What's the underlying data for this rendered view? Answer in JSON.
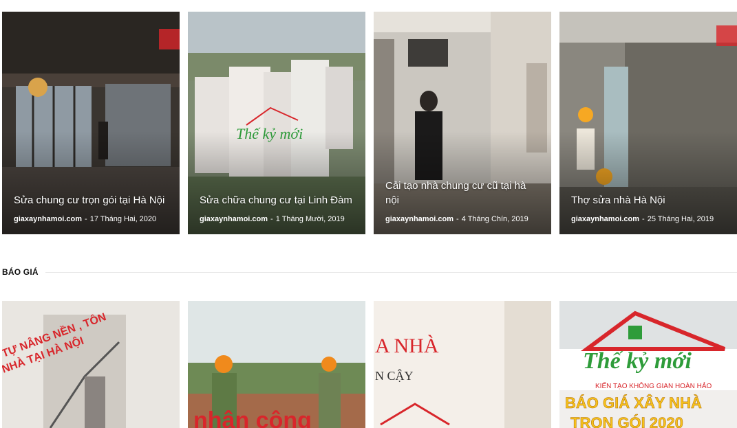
{
  "posts_top": [
    {
      "title": "Sửa chung cư trọn gói tại Hà Nội",
      "site": "giaxaynhamoi.com",
      "separator": "-",
      "date": "17 Tháng Hai, 2020"
    },
    {
      "title": "Sửa chữa chung cư tại Linh Đàm",
      "site": "giaxaynhamoi.com",
      "separator": "-",
      "date": "1 Tháng Mười, 2019"
    },
    {
      "title": "Cải tạo nhà chung cư cũ tại hà nội",
      "site": "giaxaynhamoi.com",
      "separator": "-",
      "date": "4 Tháng Chín, 2019"
    },
    {
      "title": "Thợ sửa nhà Hà Nội",
      "site": "giaxaynhamoi.com",
      "separator": "-",
      "date": "25 Tháng Hai, 2019"
    }
  ],
  "section": {
    "heading": "BÁO GIÁ"
  },
  "thumb_text": {
    "brand": "Thế kỷ mới",
    "brand_tagline": "KIẾN TẠO KHÔNG GIAN HOÀN HẢO",
    "card1_overlay_a": "TỰ NÂNG NỀN , TÔN",
    "card1_overlay_b": "NHÀ TẠI HÀ NỘI",
    "card2_overlay": "nhân công",
    "card3_overlay_a": "A NHÀ",
    "card3_overlay_b": "N CẬY",
    "card4_line_a": "BÁO GIÁ XÂY NHÀ",
    "card4_line_b": "TRỌN GÓI 2020"
  },
  "colors": {
    "brand_red": "#d8262b",
    "brand_green": "#2e9c3a",
    "accent_yellow": "#f6c21c",
    "text_dark": "#111111"
  }
}
